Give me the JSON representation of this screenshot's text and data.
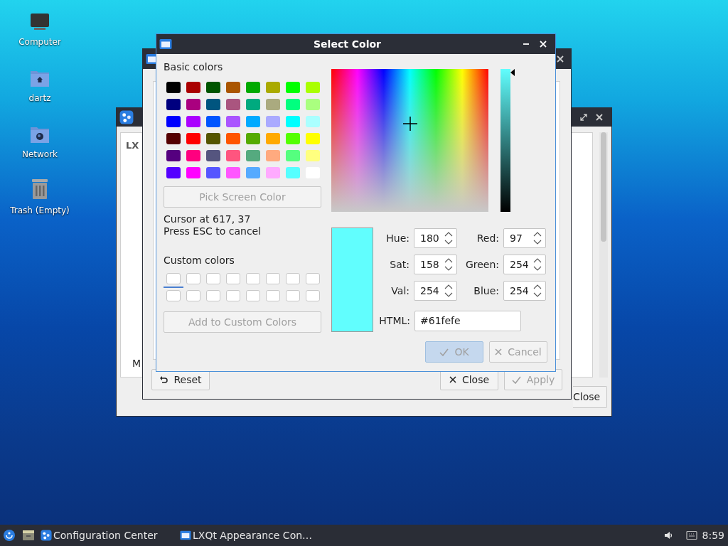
{
  "desktop": {
    "icons": [
      {
        "label": "Computer",
        "kind": "computer"
      },
      {
        "label": "dartz",
        "kind": "home"
      },
      {
        "label": "Network",
        "kind": "network"
      },
      {
        "label": "Trash (Empty)",
        "kind": "trash"
      }
    ]
  },
  "config_center_window": {
    "tab": "LX",
    "label": "M",
    "close_button": "Close"
  },
  "appearance_window": {
    "buttons": [
      {
        "label": "Reset",
        "kind": "reset",
        "disabled": false
      },
      {
        "label": "Close",
        "kind": "close",
        "disabled": false
      },
      {
        "label": "Apply",
        "kind": "apply",
        "disabled": true
      }
    ]
  },
  "dialog": {
    "title": "Select Color",
    "basic_colors_label": "Basic colors",
    "basic_colors": [
      {
        "color": "#000000"
      },
      {
        "color": "#aa0000"
      },
      {
        "color": "#005500"
      },
      {
        "color": "#aa5500"
      },
      {
        "color": "#00aa00"
      },
      {
        "color": "#aaaa00"
      },
      {
        "color": "#00ff00"
      },
      {
        "color": "#aaff00"
      },
      {
        "color": "#00007f"
      },
      {
        "color": "#aa007f"
      },
      {
        "color": "#00557f"
      },
      {
        "color": "#aa557f"
      },
      {
        "color": "#00aa7f"
      },
      {
        "color": "#aaaa7f"
      },
      {
        "color": "#00ff7f"
      },
      {
        "color": "#aaff7f"
      },
      {
        "color": "#0000ff"
      },
      {
        "color": "#aa00ff"
      },
      {
        "color": "#0055ff"
      },
      {
        "color": "#aa55ff"
      },
      {
        "color": "#00aaff"
      },
      {
        "color": "#aaaaff"
      },
      {
        "color": "#00ffff"
      },
      {
        "color": "#aaffff"
      },
      {
        "color": "#550000"
      },
      {
        "color": "#ff0000"
      },
      {
        "color": "#555500"
      },
      {
        "color": "#ff5500"
      },
      {
        "color": "#55aa00"
      },
      {
        "color": "#ffaa00"
      },
      {
        "color": "#55ff00"
      },
      {
        "color": "#ffff00"
      },
      {
        "color": "#55007f"
      },
      {
        "color": "#ff007f"
      },
      {
        "color": "#55557f"
      },
      {
        "color": "#ff557f"
      },
      {
        "color": "#55aa7f"
      },
      {
        "color": "#ffaa7f"
      },
      {
        "color": "#55ff7f"
      },
      {
        "color": "#ffff7f"
      },
      {
        "color": "#5500ff"
      },
      {
        "color": "#ff00ff"
      },
      {
        "color": "#5555ff"
      },
      {
        "color": "#ff55ff"
      },
      {
        "color": "#55aaff"
      },
      {
        "color": "#ffaaff"
      },
      {
        "color": "#55ffff"
      },
      {
        "color": "#ffffff"
      }
    ],
    "pick_button": {
      "label": "Pick Screen Color",
      "disabled": true
    },
    "cursor_text": "Cursor at 617, 37",
    "esc_text": "Press ESC to cancel",
    "custom_colors_label": "Custom colors",
    "custom_colors": [
      {
        "selected": true
      },
      {
        "selected": false
      },
      {
        "selected": false
      },
      {
        "selected": false
      },
      {
        "selected": false
      },
      {
        "selected": false
      },
      {
        "selected": false
      },
      {
        "selected": false
      },
      {
        "selected": false
      },
      {
        "selected": false
      },
      {
        "selected": false
      },
      {
        "selected": false
      },
      {
        "selected": false
      },
      {
        "selected": false
      },
      {
        "selected": false
      },
      {
        "selected": false
      }
    ],
    "add_button": {
      "label": "Add to Custom Colors",
      "disabled": true
    },
    "value_slider": {
      "level": 1
    },
    "preview": {
      "color": "#61fefe"
    },
    "fields": [
      {
        "label": "Hue:",
        "value": "180"
      },
      {
        "label": "Red:",
        "value": "97"
      },
      {
        "label": "Sat:",
        "value": "158"
      },
      {
        "label": "Green:",
        "value": "254"
      },
      {
        "label": "Val:",
        "value": "254"
      },
      {
        "label": "Blue:",
        "value": "254"
      }
    ],
    "html": {
      "label": "HTML:",
      "value": "#61fefe"
    },
    "buttons": [
      {
        "label": "OK",
        "kind": "ok",
        "default": true,
        "disabled": true
      },
      {
        "label": "Cancel",
        "kind": "cancel",
        "default": false,
        "disabled": true
      }
    ]
  },
  "taskbar": {
    "tasks": [
      {
        "label": "Configuration Center",
        "kind": "config"
      },
      {
        "label": "LXQt Appearance Con…",
        "kind": "appearance"
      }
    ],
    "clock": "8:59"
  }
}
